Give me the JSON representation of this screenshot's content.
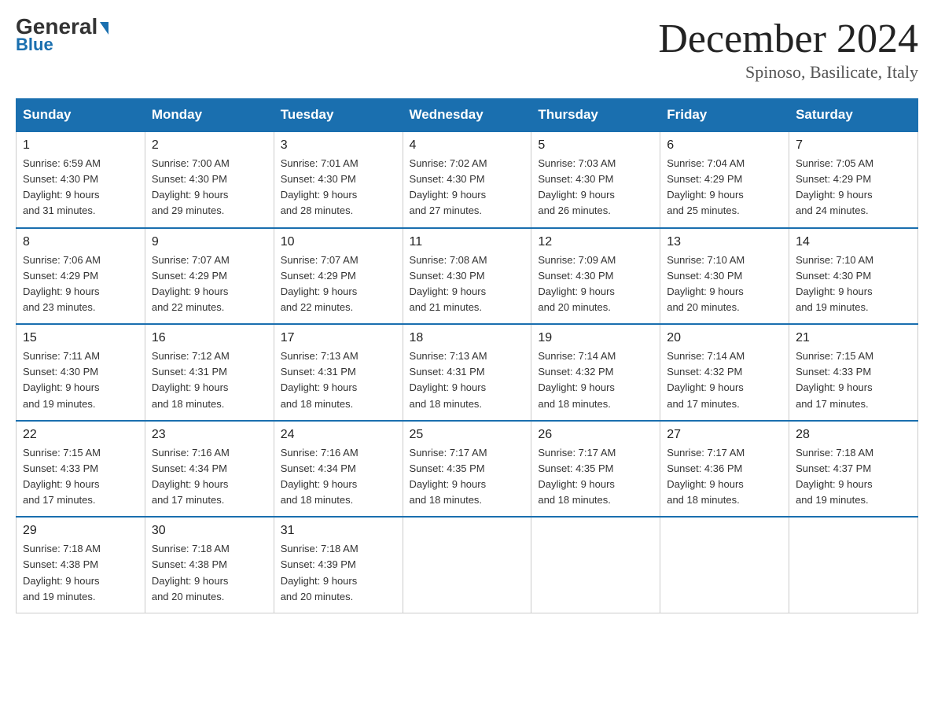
{
  "header": {
    "logo_general": "General",
    "logo_blue": "Blue",
    "month_title": "December 2024",
    "location": "Spinoso, Basilicate, Italy"
  },
  "days_of_week": [
    "Sunday",
    "Monday",
    "Tuesday",
    "Wednesday",
    "Thursday",
    "Friday",
    "Saturday"
  ],
  "weeks": [
    [
      {
        "day": 1,
        "sunrise": "6:59 AM",
        "sunset": "4:30 PM",
        "daylight": "9 hours and 31 minutes."
      },
      {
        "day": 2,
        "sunrise": "7:00 AM",
        "sunset": "4:30 PM",
        "daylight": "9 hours and 29 minutes."
      },
      {
        "day": 3,
        "sunrise": "7:01 AM",
        "sunset": "4:30 PM",
        "daylight": "9 hours and 28 minutes."
      },
      {
        "day": 4,
        "sunrise": "7:02 AM",
        "sunset": "4:30 PM",
        "daylight": "9 hours and 27 minutes."
      },
      {
        "day": 5,
        "sunrise": "7:03 AM",
        "sunset": "4:30 PM",
        "daylight": "9 hours and 26 minutes."
      },
      {
        "day": 6,
        "sunrise": "7:04 AM",
        "sunset": "4:29 PM",
        "daylight": "9 hours and 25 minutes."
      },
      {
        "day": 7,
        "sunrise": "7:05 AM",
        "sunset": "4:29 PM",
        "daylight": "9 hours and 24 minutes."
      }
    ],
    [
      {
        "day": 8,
        "sunrise": "7:06 AM",
        "sunset": "4:29 PM",
        "daylight": "9 hours and 23 minutes."
      },
      {
        "day": 9,
        "sunrise": "7:07 AM",
        "sunset": "4:29 PM",
        "daylight": "9 hours and 22 minutes."
      },
      {
        "day": 10,
        "sunrise": "7:07 AM",
        "sunset": "4:29 PM",
        "daylight": "9 hours and 22 minutes."
      },
      {
        "day": 11,
        "sunrise": "7:08 AM",
        "sunset": "4:30 PM",
        "daylight": "9 hours and 21 minutes."
      },
      {
        "day": 12,
        "sunrise": "7:09 AM",
        "sunset": "4:30 PM",
        "daylight": "9 hours and 20 minutes."
      },
      {
        "day": 13,
        "sunrise": "7:10 AM",
        "sunset": "4:30 PM",
        "daylight": "9 hours and 20 minutes."
      },
      {
        "day": 14,
        "sunrise": "7:10 AM",
        "sunset": "4:30 PM",
        "daylight": "9 hours and 19 minutes."
      }
    ],
    [
      {
        "day": 15,
        "sunrise": "7:11 AM",
        "sunset": "4:30 PM",
        "daylight": "9 hours and 19 minutes."
      },
      {
        "day": 16,
        "sunrise": "7:12 AM",
        "sunset": "4:31 PM",
        "daylight": "9 hours and 18 minutes."
      },
      {
        "day": 17,
        "sunrise": "7:13 AM",
        "sunset": "4:31 PM",
        "daylight": "9 hours and 18 minutes."
      },
      {
        "day": 18,
        "sunrise": "7:13 AM",
        "sunset": "4:31 PM",
        "daylight": "9 hours and 18 minutes."
      },
      {
        "day": 19,
        "sunrise": "7:14 AM",
        "sunset": "4:32 PM",
        "daylight": "9 hours and 18 minutes."
      },
      {
        "day": 20,
        "sunrise": "7:14 AM",
        "sunset": "4:32 PM",
        "daylight": "9 hours and 17 minutes."
      },
      {
        "day": 21,
        "sunrise": "7:15 AM",
        "sunset": "4:33 PM",
        "daylight": "9 hours and 17 minutes."
      }
    ],
    [
      {
        "day": 22,
        "sunrise": "7:15 AM",
        "sunset": "4:33 PM",
        "daylight": "9 hours and 17 minutes."
      },
      {
        "day": 23,
        "sunrise": "7:16 AM",
        "sunset": "4:34 PM",
        "daylight": "9 hours and 17 minutes."
      },
      {
        "day": 24,
        "sunrise": "7:16 AM",
        "sunset": "4:34 PM",
        "daylight": "9 hours and 18 minutes."
      },
      {
        "day": 25,
        "sunrise": "7:17 AM",
        "sunset": "4:35 PM",
        "daylight": "9 hours and 18 minutes."
      },
      {
        "day": 26,
        "sunrise": "7:17 AM",
        "sunset": "4:35 PM",
        "daylight": "9 hours and 18 minutes."
      },
      {
        "day": 27,
        "sunrise": "7:17 AM",
        "sunset": "4:36 PM",
        "daylight": "9 hours and 18 minutes."
      },
      {
        "day": 28,
        "sunrise": "7:18 AM",
        "sunset": "4:37 PM",
        "daylight": "9 hours and 19 minutes."
      }
    ],
    [
      {
        "day": 29,
        "sunrise": "7:18 AM",
        "sunset": "4:38 PM",
        "daylight": "9 hours and 19 minutes."
      },
      {
        "day": 30,
        "sunrise": "7:18 AM",
        "sunset": "4:38 PM",
        "daylight": "9 hours and 20 minutes."
      },
      {
        "day": 31,
        "sunrise": "7:18 AM",
        "sunset": "4:39 PM",
        "daylight": "9 hours and 20 minutes."
      },
      null,
      null,
      null,
      null
    ]
  ]
}
